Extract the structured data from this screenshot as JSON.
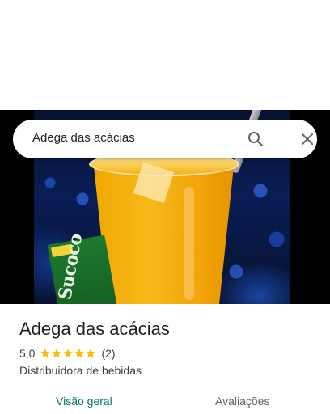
{
  "search": {
    "query": "Adega das acácias",
    "search_icon": "search-icon",
    "close_icon": "close-icon"
  },
  "hero": {
    "image": "photo of an orange drink in a plastic cup next to a green coconut water carton",
    "carton_text": "Sucoco"
  },
  "place": {
    "name": "Adega das acácias",
    "rating": "5,0",
    "stars": 5,
    "review_count": "(2)",
    "category": "Distribuidora de bebidas"
  },
  "tabs": [
    {
      "label": "Visão geral",
      "active": true
    },
    {
      "label": "Avaliações",
      "active": false
    }
  ],
  "colors": {
    "accent": "#00796b",
    "star": "#fbbc04",
    "text": "#202124",
    "secondary_text": "#3c4043"
  }
}
